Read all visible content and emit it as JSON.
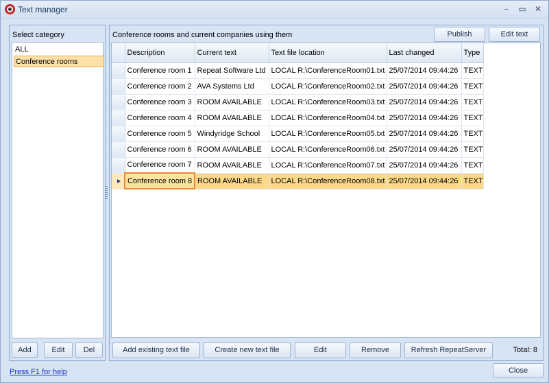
{
  "window": {
    "title": "Text manager",
    "minimize": "–",
    "maximize": "▭",
    "close": "✕"
  },
  "category_panel": {
    "label": "Select category",
    "items": [
      {
        "label": "ALL",
        "selected": false
      },
      {
        "label": "Conference rooms",
        "selected": true
      }
    ],
    "buttons": {
      "add": "Add",
      "edit": "Edit",
      "del": "Del"
    }
  },
  "main_panel": {
    "title": "Conference rooms and current companies using them",
    "buttons": {
      "publish": "Publish",
      "edit_text": "Edit text"
    },
    "columns": [
      "Description",
      "Current text",
      "Text file location",
      "Last changed",
      "Type"
    ],
    "rows": [
      [
        "Conference room 1",
        "Repeat Software Ltd",
        "LOCAL R:\\ConferenceRoom01.txt",
        "25/07/2014 09:44:26",
        "TEXT"
      ],
      [
        "Conference room 2",
        "AVA Systems Ltd",
        "LOCAL R:\\ConferenceRoom02.txt",
        "25/07/2014 09:44:26",
        "TEXT"
      ],
      [
        "Conference room 3",
        "ROOM AVAILABLE",
        "LOCAL R:\\ConferenceRoom03.txt",
        "25/07/2014 09:44:26",
        "TEXT"
      ],
      [
        "Conference room 4",
        "ROOM AVAILABLE",
        "LOCAL R:\\ConferenceRoom04.txt",
        "25/07/2014 09:44:26",
        "TEXT"
      ],
      [
        "Conference room 5",
        "Windyridge School",
        "LOCAL R:\\ConferenceRoom05.txt",
        "25/07/2014 09:44:26",
        "TEXT"
      ],
      [
        "Conference room 6",
        "ROOM AVAILABLE",
        "LOCAL R:\\ConferenceRoom06.txt",
        "25/07/2014 09:44:26",
        "TEXT"
      ],
      [
        "Conference room 7",
        "ROOM AVAILABLE",
        "LOCAL R:\\ConferenceRoom07.txt",
        "25/07/2014 09:44:26",
        "TEXT"
      ],
      [
        "Conference room 8",
        "ROOM AVAILABLE",
        "LOCAL R:\\ConferenceRoom08.txt",
        "25/07/2014 09:44:26",
        "TEXT"
      ]
    ],
    "selected_row": 7,
    "bottom_buttons": {
      "add_existing": "Add existing text file",
      "create_new": "Create new text file",
      "edit": "Edit",
      "remove": "Remove",
      "refresh": "Refresh RepeatServer"
    },
    "total": "Total: 8"
  },
  "footer": {
    "help": "Press F1 for help",
    "close": "Close"
  },
  "colors": {
    "selection": "#fbd88a",
    "focus_border": "#e58a3a",
    "link": "#1a33c8"
  }
}
